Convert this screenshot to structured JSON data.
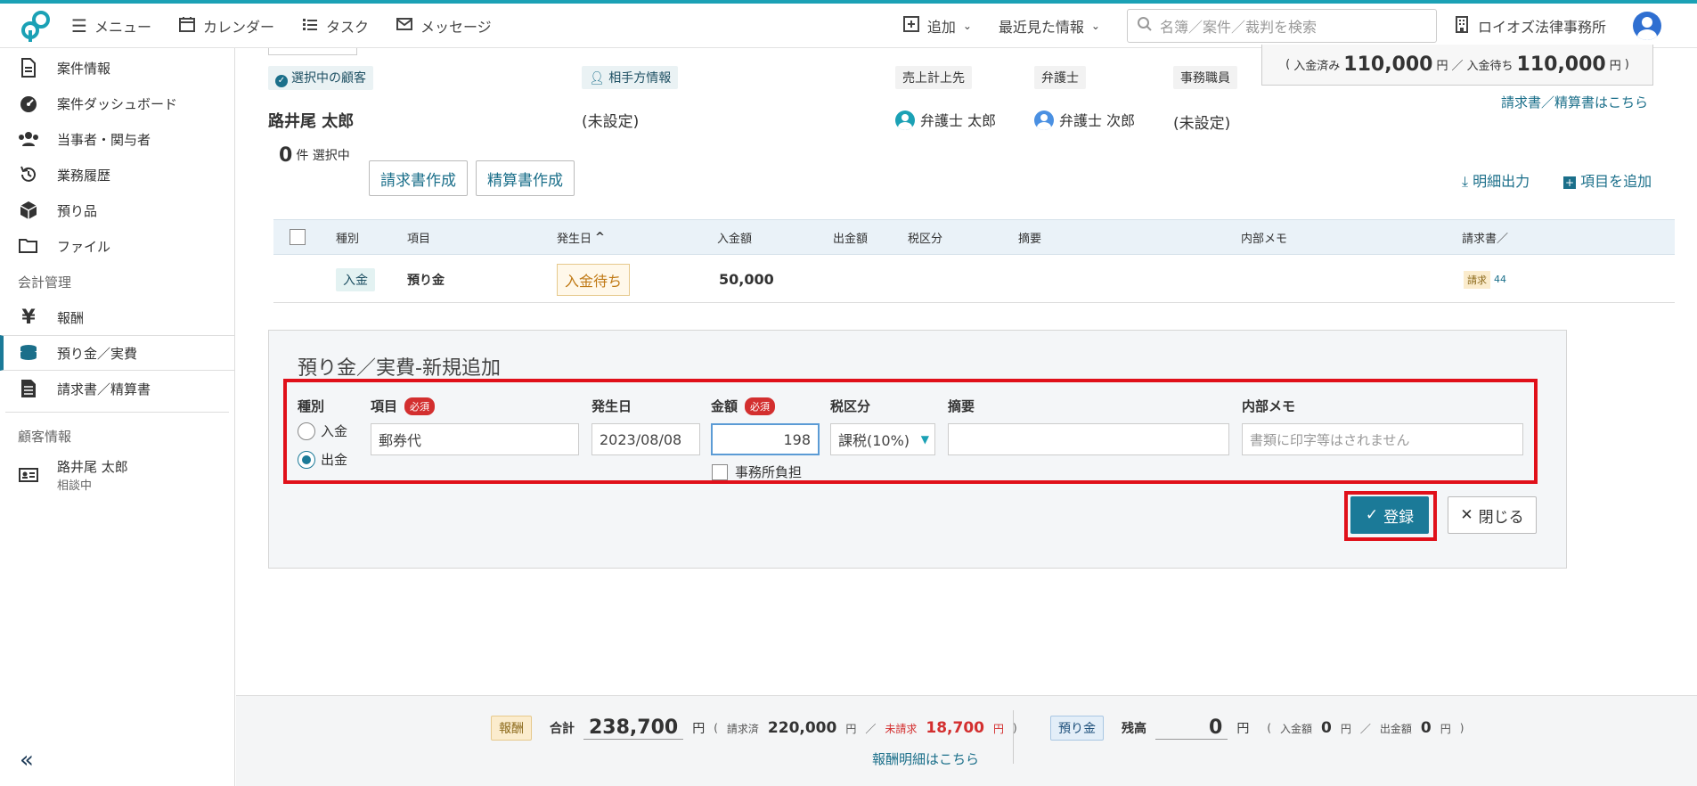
{
  "nav": {
    "menu": "メニュー",
    "calendar": "カレンダー",
    "tasks": "タスク",
    "messages": "メッセージ",
    "add": "追加",
    "recent": "最近見た情報",
    "search_placeholder": "名簿／案件／裁判を検索",
    "firm": "ロイオズ法律事務所"
  },
  "sidebar": {
    "items": [
      {
        "label": "案件情報",
        "icon": "document-icon"
      },
      {
        "label": "案件ダッシュボード",
        "icon": "dashboard-icon"
      },
      {
        "label": "当事者・関与者",
        "icon": "users-icon"
      },
      {
        "label": "業務履歴",
        "icon": "history-icon"
      },
      {
        "label": "預り品",
        "icon": "box-icon"
      },
      {
        "label": "ファイル",
        "icon": "folder-icon"
      }
    ],
    "section_accounting": "会計管理",
    "accounting_items": [
      {
        "label": "報酬",
        "icon": "yen-icon"
      },
      {
        "label": "預り金／実費",
        "icon": "coins-icon"
      },
      {
        "label": "請求書／精算書",
        "icon": "invoice-icon"
      }
    ],
    "section_client": "顧客情報",
    "client": {
      "name": "路井尾 太郎",
      "status": "相談中"
    }
  },
  "header": {
    "selected_client_label": "選択中の顧客",
    "client_name": "路井尾 太郎",
    "opponent_label": "相手方情報",
    "opponent_value": "(未設定)",
    "sales_label": "売上計上先",
    "sales_value": "弁護士 太郎",
    "lawyer_label": "弁護士",
    "lawyer_value": "弁護士 次郎",
    "staff_label": "事務職員",
    "staff_value": "(未設定)",
    "paid_label": "入金済み",
    "paid_value": "110,000",
    "pending_label": "入金待ち",
    "pending_value": "110,000",
    "yen": "円",
    "invoice_link": "請求書／精算書はこちら"
  },
  "toolbar": {
    "selected_count": "0",
    "selected_suffix": "件 選択中",
    "create_invoice": "請求書作成",
    "create_statement": "精算書作成",
    "export": "明細出力",
    "add_item": "項目を追加"
  },
  "table": {
    "headers": [
      "種別",
      "項目",
      "発生日",
      "入金額",
      "出金額",
      "税区分",
      "摘要",
      "内部メモ",
      "請求書／"
    ],
    "sort_indicator": "^",
    "row": {
      "type": "入金",
      "item": "預り金",
      "status": "入金待ち",
      "amount": "50,000",
      "invoice_tag": "請求",
      "invoice_no": "44"
    }
  },
  "form": {
    "title": "預り金／実費-新規追加",
    "type_label": "種別",
    "type_in": "入金",
    "type_out": "出金",
    "item_label": "項目",
    "required": "必須",
    "item_value": "郵券代",
    "date_label": "発生日",
    "date_value": "2023/08/08",
    "amount_label": "金額",
    "amount_value": "198",
    "office_burden": "事務所負担",
    "tax_label": "税区分",
    "tax_value": "課税(10%)",
    "summary_label": "摘要",
    "memo_label": "内部メモ",
    "memo_placeholder": "書類に印字等はされません",
    "submit": "登録",
    "close": "閉じる"
  },
  "footer": {
    "fee_tag": "報酬",
    "total_label": "合計",
    "total_value": "238,700",
    "yen": "円",
    "billed_label": "請求済",
    "billed_value": "220,000",
    "unbilled_label": "未請求",
    "unbilled_value": "18,700",
    "fee_link": "報酬明細はこちら",
    "deposit_tag": "預り金",
    "balance_label": "残高",
    "balance_value": "0",
    "in_label": "入金額",
    "in_value": "0",
    "out_label": "出金額",
    "out_value": "0"
  }
}
